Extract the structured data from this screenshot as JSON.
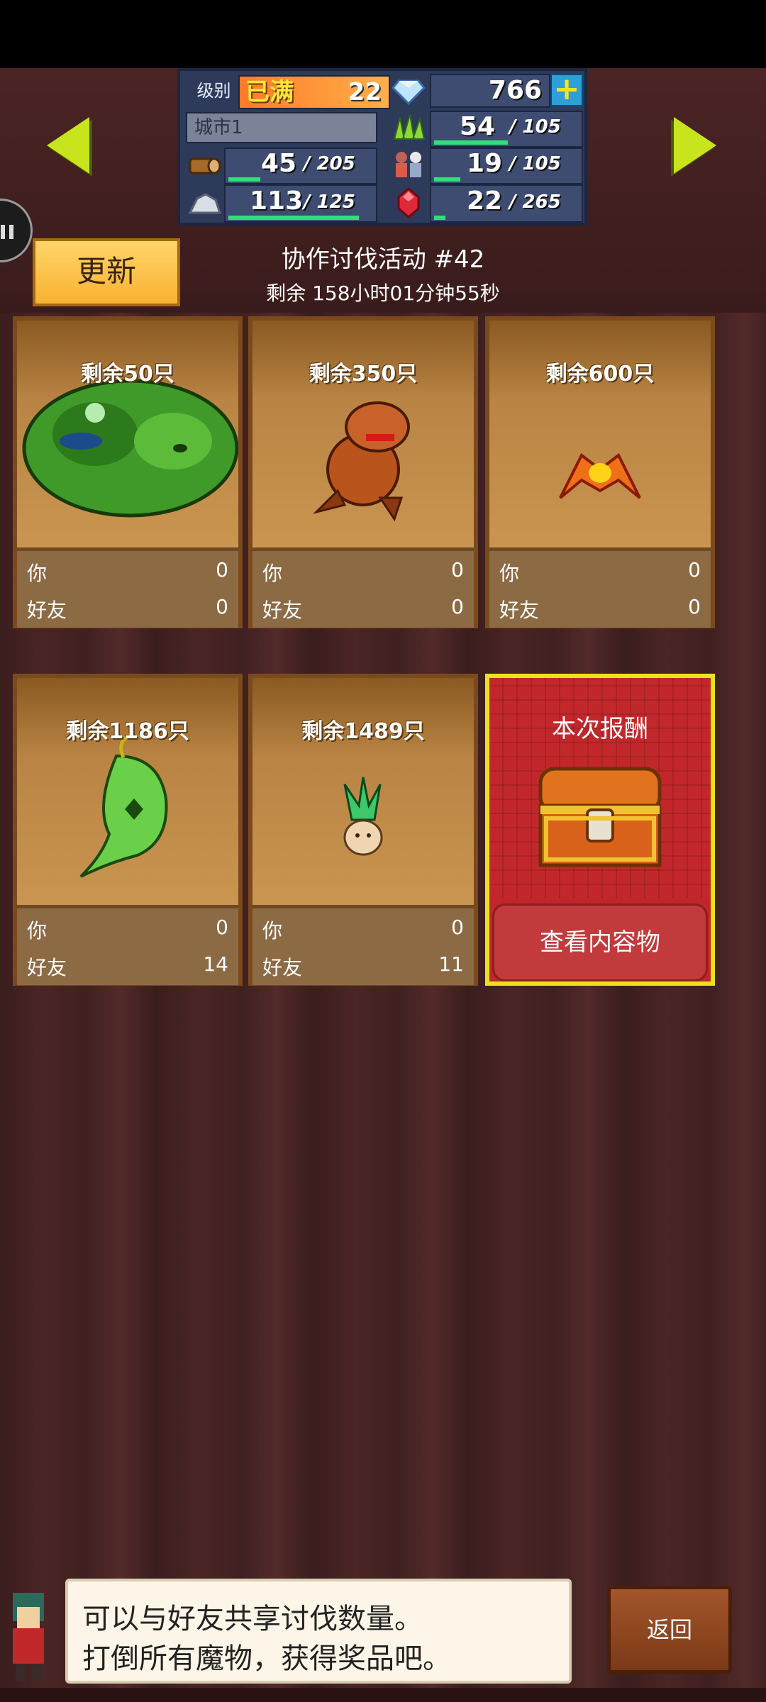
{
  "status": {
    "level_label": "级别",
    "level_max": "已满",
    "level_value": "22",
    "gems": "766",
    "city": "城市1"
  },
  "resources": {
    "grass": {
      "current": "54",
      "max": "/ 105",
      "fill": 0.51
    },
    "wood": {
      "current": "45",
      "max": "/ 205",
      "fill": 0.22
    },
    "people": {
      "current": "19",
      "max": "/ 105",
      "fill": 0.18
    },
    "stone": {
      "current": "113",
      "max": "/ 125",
      "fill": 0.9
    },
    "ruby": {
      "current": "22",
      "max": "/ 265",
      "fill": 0.08
    }
  },
  "header": {
    "update_label": "更新",
    "event_title": "协作讨伐活动 #42",
    "event_remaining": "剩余 158小时01分钟55秒"
  },
  "cards": [
    {
      "count": "剩余50只",
      "monster": "green-slime",
      "you_label": "你",
      "you_value": "0",
      "friend_label": "好友",
      "friend_value": "0"
    },
    {
      "count": "剩余350只",
      "monster": "orange-dragon",
      "you_label": "你",
      "you_value": "0",
      "friend_label": "好友",
      "friend_value": "0"
    },
    {
      "count": "剩余600只",
      "monster": "fire-bat",
      "you_label": "你",
      "you_value": "0",
      "friend_label": "好友",
      "friend_value": "0"
    },
    {
      "count": "剩余1186只",
      "monster": "leaf-ghost",
      "you_label": "你",
      "you_value": "0",
      "friend_label": "好友",
      "friend_value": "14"
    },
    {
      "count": "剩余1489只",
      "monster": "mandrake",
      "you_label": "你",
      "you_value": "0",
      "friend_label": "好友",
      "friend_value": "11"
    }
  ],
  "reward": {
    "title": "本次报酬",
    "view_label": "查看内容物"
  },
  "hint": {
    "line1": "可以与好友共享讨伐数量。",
    "line2": "打倒所有魔物，获得奖品吧。"
  },
  "back_label": "返回",
  "colors": {
    "accent_yellow": "#c7e41c",
    "panel_blue": "#2d3a5a",
    "reward_red": "#c0262a",
    "card_brown": "#b07a3c"
  }
}
